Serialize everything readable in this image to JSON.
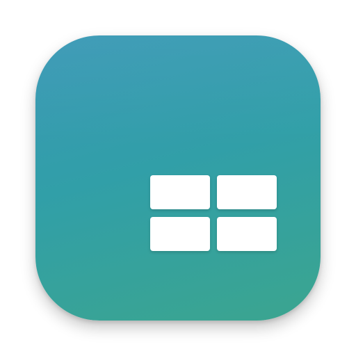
{
  "app_icon": {
    "icon": "grid-2x2-icon",
    "colors": {
      "gradient_top": "#3a98b6",
      "gradient_middle": "#319fa8",
      "gradient_bottom": "#3ba58f",
      "tile": "#ffffff"
    },
    "tiles": [
      {
        "icon": "tile-top-left"
      },
      {
        "icon": "tile-top-right"
      },
      {
        "icon": "tile-bottom-left"
      },
      {
        "icon": "tile-bottom-right"
      }
    ]
  }
}
